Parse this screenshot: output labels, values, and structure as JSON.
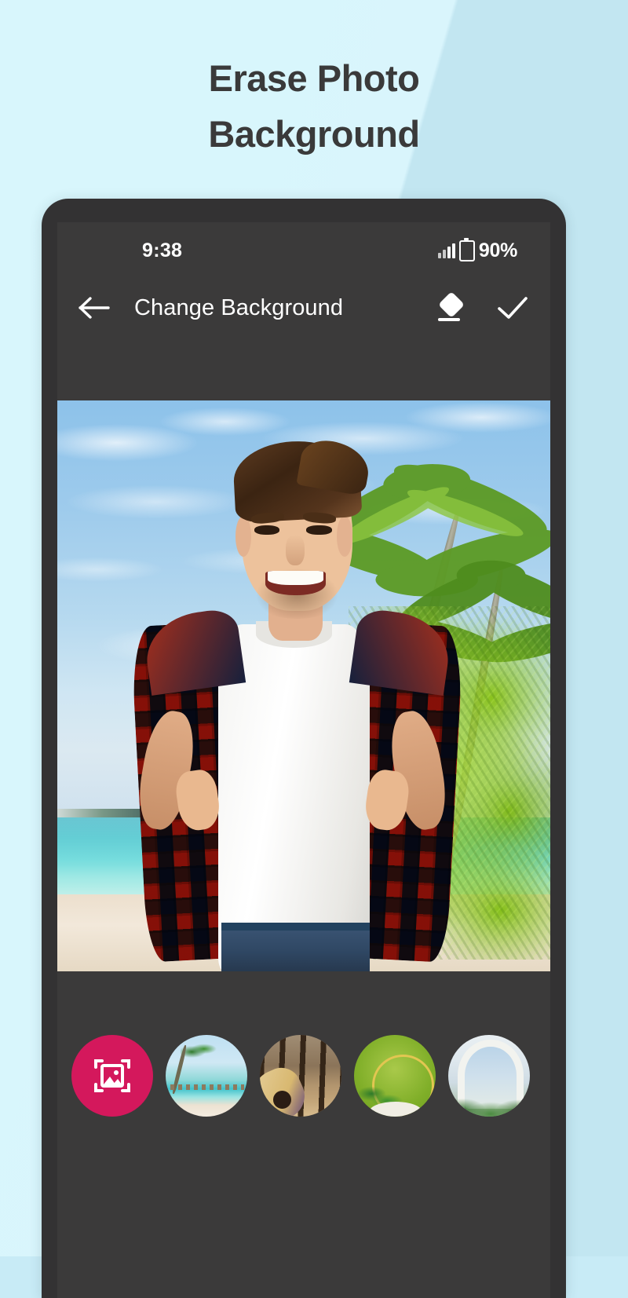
{
  "promo": {
    "headline_line1": "Erase Photo",
    "headline_line2": "Background",
    "bg_color_light": "#d9f5fc",
    "bg_color_base": "#c2e6f1",
    "headline_color": "#3a3a3a"
  },
  "phone": {
    "frame_color": "#333233",
    "screen_color": "#3b3a3a"
  },
  "status_bar": {
    "time": "9:38",
    "battery_percent": "90%",
    "signal_icon": "signal-bars-icon",
    "battery_icon": "battery-charging-icon"
  },
  "toolbar": {
    "back_icon": "arrow-left-icon",
    "title": "Change Background",
    "eraser_icon": "eraser-icon",
    "confirm_icon": "check-icon"
  },
  "canvas": {
    "subject_description": "Smiling young man with brown swept-back hair and stubble wearing an open red and navy plaid shirt over a white t-shirt and blue jeans",
    "background_description": "Tropical beach with blue cloudy sky, leaning palm trees, turquoise lagoon, white sand and bright green shrubs"
  },
  "backgrounds": {
    "gallery_button": {
      "label": "gallery-picker",
      "icon": "image-frame-icon",
      "color": "#d4185c"
    },
    "items": [
      {
        "id": "beach",
        "label": "Palm beach with overwater bungalows"
      },
      {
        "id": "forest-guitar",
        "label": "Acoustic guitar in autumn forest"
      },
      {
        "id": "green-podium",
        "label": "Green podium with gold ring and palm leaves"
      },
      {
        "id": "white-arch",
        "label": "White arch with sky and tropical plants"
      }
    ]
  }
}
